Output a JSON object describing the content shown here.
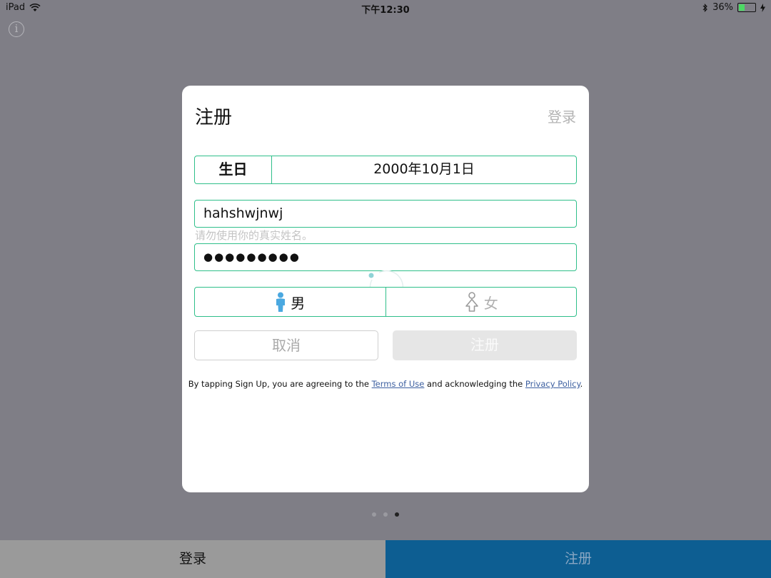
{
  "status_bar": {
    "device": "iPad",
    "time": "下午12:30",
    "battery_percent": "36%",
    "battery_level": 0.36,
    "icons": [
      "wifi-icon",
      "bluetooth-icon",
      "battery-icon",
      "charging-icon"
    ]
  },
  "dialog": {
    "title": "注册",
    "login_link": "登录",
    "birthday": {
      "label": "生日",
      "value": "2000年10月1日"
    },
    "name": {
      "value": "hahshwjnwj",
      "hint": "请勿使用你的真实姓名。"
    },
    "password": {
      "masked_value": "●●●●●●●●●"
    },
    "gender": {
      "male": "男",
      "female": "女",
      "selected": "male"
    },
    "buttons": {
      "cancel": "取消",
      "signup": "注册"
    },
    "terms": {
      "prefix": "By tapping Sign Up, you are agreeing to the ",
      "terms_link": "Terms of Use",
      "middle": " and acknowledging the ",
      "privacy_link": "Privacy Policy",
      "suffix": "."
    }
  },
  "pager": {
    "count": 3,
    "active_index": 2
  },
  "bottom_tabs": {
    "login": "登录",
    "register": "注册"
  },
  "colors": {
    "accent_border": "#2fbf8a",
    "male_icon": "#4aa8e0",
    "register_tab": "#0d5e92",
    "overlay": "#7f7e86"
  }
}
